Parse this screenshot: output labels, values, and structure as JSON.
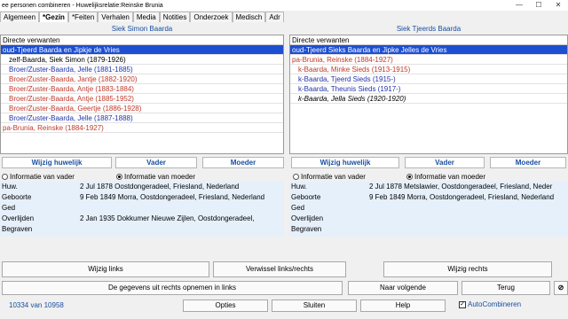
{
  "window": {
    "title": "ee personen combineren - Huwelijksrelatie:Reinske Brunia",
    "minimize": "—",
    "maximize": "☐",
    "close": "✕"
  },
  "tabs": [
    "Algemeen",
    "*Gezin",
    "*Feiten",
    "Verhalen",
    "Media",
    "Notities",
    "Onderzoek",
    "Medisch",
    "Adr"
  ],
  "left": {
    "name": "Siek Simon Baarda",
    "list_header": "Directe verwanten",
    "rows": [
      "oud-Tjeerd Baarda en Jipkje de Vries",
      "zelf-Baarda, Siek Simon (1879-1926)",
      "Broer/Zuster-Baarda, Jelle (1881-1885)",
      "Broer/Zuster-Baarda, Jantje (1882-1920)",
      "Broer/Zuster-Baarda, Antje (1883-1884)",
      "Broer/Zuster-Baarda, Antje (1885-1952)",
      "Broer/Zuster-Baarda, Geertje (1886-1928)",
      "Broer/Zuster-Baarda, Jelle (1887-1888)",
      "pa-Brunia, Reinske (1884-1927)"
    ],
    "btn_marriage": "Wijzig huwelijk",
    "btn_father": "Vader",
    "btn_mother": "Moeder",
    "radio_father": "Informatie van vader",
    "radio_mother": "Informatie van moeder",
    "info": [
      {
        "label": "Huw.",
        "value": "2 Jul 1878 Oostdongeradeel, Friesland, Nederland"
      },
      {
        "label": "Geboorte",
        "value": "9 Feb 1849 Morra, Oostdongeradeel, Friesland, Nederland"
      },
      {
        "label": "Ged",
        "value": ""
      },
      {
        "label": "Overlijden",
        "value": "2 Jan 1935 Dokkumer Nieuwe Zijlen, Oostdongeradeel,"
      },
      {
        "label": "Begraven",
        "value": ""
      }
    ]
  },
  "right": {
    "name": "Siek Tjeerds Baarda",
    "list_header": "Directe verwanten",
    "rows": [
      "oud-Tjeerd Sieks Baarda en Jipke Jelles de Vries",
      "pa-Brunia, Reinske (1884-1927)",
      "k-Baarda, Minke Sieds (1913-1915)",
      "k-Baarda, Tjeerd Sieds (1915-)",
      "k-Baarda, Theunis Sieds (1917-)",
      "k-Baarda, Jella Sieds (1920-1920)"
    ],
    "btn_marriage": "Wijzig huwelijk",
    "btn_father": "Vader",
    "btn_mother": "Moeder",
    "radio_father": "Informatie van vader",
    "radio_mother": "Informatie van moeder",
    "info": [
      {
        "label": "Huw.",
        "value": "2 Jul 1878 Metslawier, Oostdongeradeel, Friesland, Neder"
      },
      {
        "label": "Geboorte",
        "value": "9 Feb 1849 Morra, Oostdongeradeel, Friesland, Nederland"
      },
      {
        "label": "Ged",
        "value": ""
      },
      {
        "label": "Overlijden",
        "value": ""
      },
      {
        "label": "Begraven",
        "value": ""
      }
    ]
  },
  "buttons": {
    "edit_left": "Wijzig links",
    "swap": "Verwissel links/rechts",
    "edit_right": "Wijzig rechts",
    "copy_right_to_left": "De gegevens uit rechts opnemen in links",
    "next": "Naar volgende",
    "back": "Terug",
    "options": "Opties",
    "close": "Sluiten",
    "help": "Help"
  },
  "status": {
    "counter": "10334 van 10958",
    "auto_combine_label": "AutoCombineren",
    "auto_combine_checked": true
  }
}
